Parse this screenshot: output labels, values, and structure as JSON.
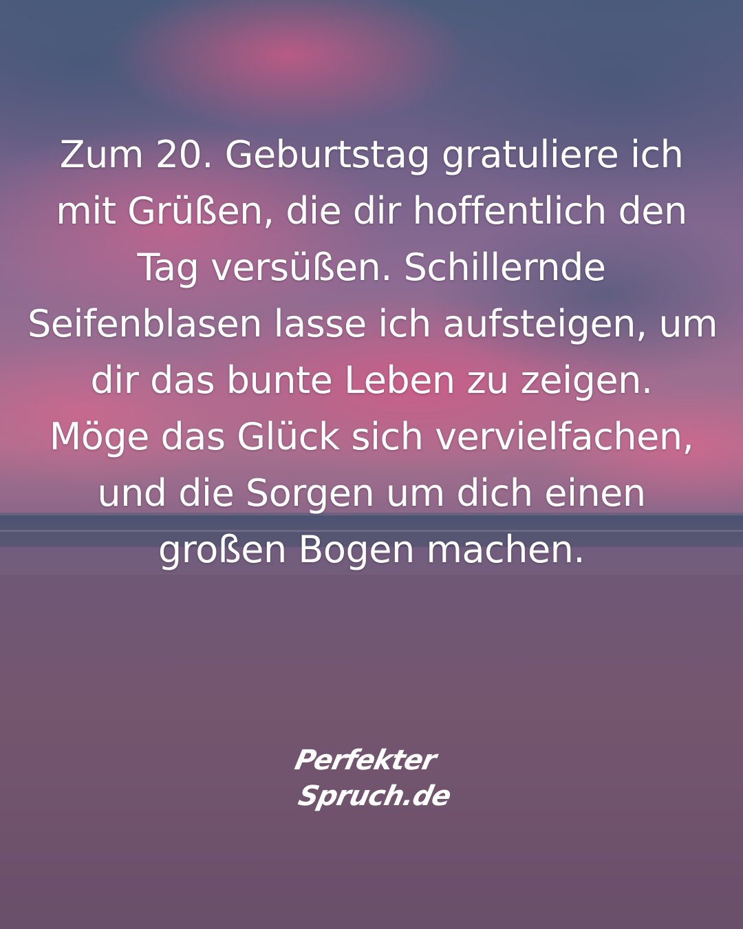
{
  "quote": {
    "lines": [
      "Zum 20. Geburtstag gratuliere ich",
      "mit Grüßen, die dir hoffentlich den",
      "Tag versüßen. Schillernde",
      "Seifenblasen lasse ich aufsteigen, um",
      "dir das bunte Leben zu zeigen.",
      "Möge das Glück sich vervielfachen,",
      "und die Sorgen um dich einen",
      "großen Bogen machen."
    ]
  },
  "logo": {
    "line1": "Perfekter",
    "line2": "Spruch.de"
  },
  "colors": {
    "sky_top": "#4a5a7a",
    "sky_pink": "#c8577e",
    "horizon_glow": "#e0708f",
    "sea": "#3f4a66",
    "sand": "#6e5470",
    "text": "#ffffff"
  }
}
